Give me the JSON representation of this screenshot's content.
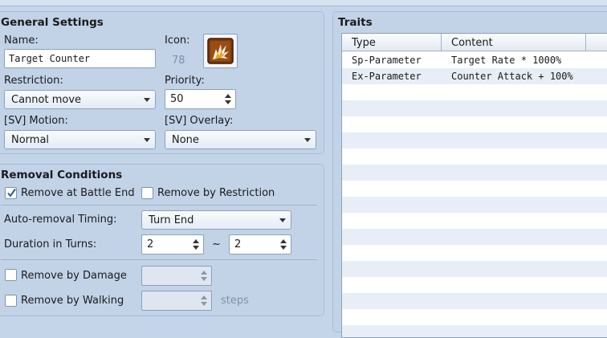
{
  "general": {
    "title": "General Settings",
    "name_label": "Name:",
    "name_value": "Target Counter",
    "icon_label": "Icon:",
    "icon_index": "78",
    "restriction_label": "Restriction:",
    "restriction_value": "Cannot move",
    "priority_label": "Priority:",
    "priority_value": "50",
    "motion_label": "[SV] Motion:",
    "motion_value": "Normal",
    "overlay_label": "[SV] Overlay:",
    "overlay_value": "None"
  },
  "removal": {
    "title": "Removal Conditions",
    "battle_end_label": "Remove at Battle End",
    "battle_end_checked": true,
    "restriction_label": "Remove by Restriction",
    "restriction_checked": false,
    "timing_label": "Auto-removal Timing:",
    "timing_value": "Turn End",
    "duration_label": "Duration in Turns:",
    "duration_min": "2",
    "duration_sep": "~",
    "duration_max": "2",
    "damage_label": "Remove by Damage",
    "walking_label": "Remove by Walking",
    "steps_label": "steps"
  },
  "traits": {
    "title": "Traits",
    "columns": [
      "Type",
      "Content"
    ],
    "rows": [
      {
        "type": "Sp-Parameter",
        "content": "Target Rate * 1000%"
      },
      {
        "type": "Ex-Parameter",
        "content": "Counter Attack + 100%"
      }
    ]
  },
  "colors": {
    "panel": "#c2d3e8",
    "background": "#c5d5e9",
    "row_stripe": "#e7eef6",
    "icon_brown": "#7a3a0c",
    "check_blue": "#2d5a9c"
  },
  "icons": {
    "state_icon": "burst-icon",
    "checkmark": "check-icon"
  }
}
